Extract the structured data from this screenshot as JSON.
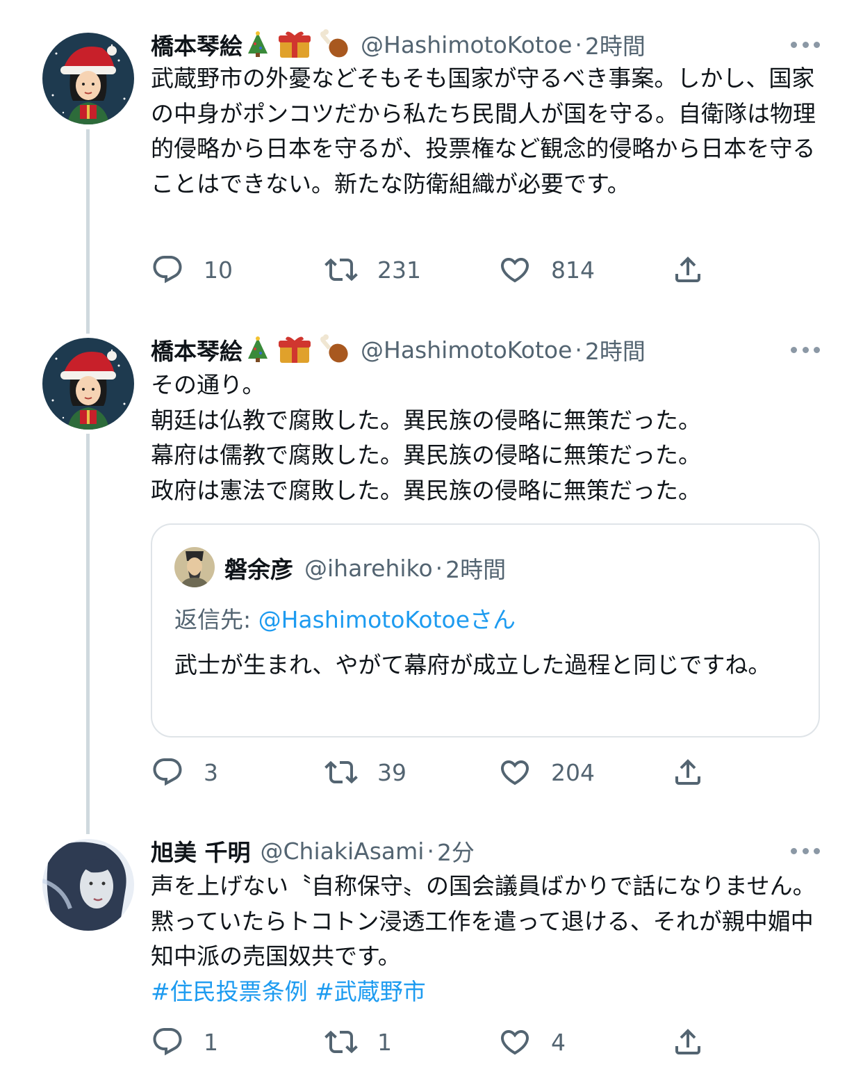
{
  "tweets": [
    {
      "name": "橋本琴絵",
      "handle": "@HashimotoKotoe",
      "time": "2時間",
      "text": "武蔵野市の外憂などそもそも国家が守るべき事案。しかし、国家の中身がポンコツだから私たち民間人が国を守る。自衛隊は物理的侵略から日本を守るが、投票権など観念的侵略から日本を守ることはできない。新たな防衛組織が必要です。",
      "reply_count": "10",
      "retweet_count": "231",
      "like_count": "814"
    },
    {
      "name": "橋本琴絵",
      "handle": "@HashimotoKotoe",
      "time": "2時間",
      "text": "その通り。\n朝廷は仏教で腐敗した。異民族の侵略に無策だった。\n幕府は儒教で腐敗した。異民族の侵略に無策だった。\n政府は憲法で腐敗した。異民族の侵略に無策だった。",
      "quote": {
        "name": "磐余彦",
        "handle": "@iharehiko",
        "time": "2時間",
        "reply_prefix": "返信先: ",
        "reply_mention": "@HashimotoKotoe",
        "reply_suffix": "さん",
        "text": "武士が生まれ、やがて幕府が成立した過程と同じですね。"
      },
      "reply_count": "3",
      "retweet_count": "39",
      "like_count": "204"
    },
    {
      "name": "旭美 千明",
      "handle": "@ChiakiAsami",
      "time": "2分",
      "text": "声を上げない〝自称保守〟の国会議員ばかりで話になりません。黙っていたらトコトン浸透工作を遣って退ける、それが親中媚中知中派の売国奴共です。",
      "hashtags": "#住民投票条例 #武蔵野市",
      "reply_count": "1",
      "retweet_count": "1",
      "like_count": "4"
    }
  ],
  "sep": "·",
  "icons": [
    "reply-icon",
    "retweet-icon",
    "like-icon",
    "share-icon",
    "more-icon",
    "tree-emoji",
    "gift-emoji",
    "drumstick-emoji"
  ],
  "colors": {
    "text": "#0f1419",
    "secondary": "#536471",
    "link": "#1d9bf0",
    "border": "#dfe4e8",
    "thread": "#cfd9de"
  }
}
